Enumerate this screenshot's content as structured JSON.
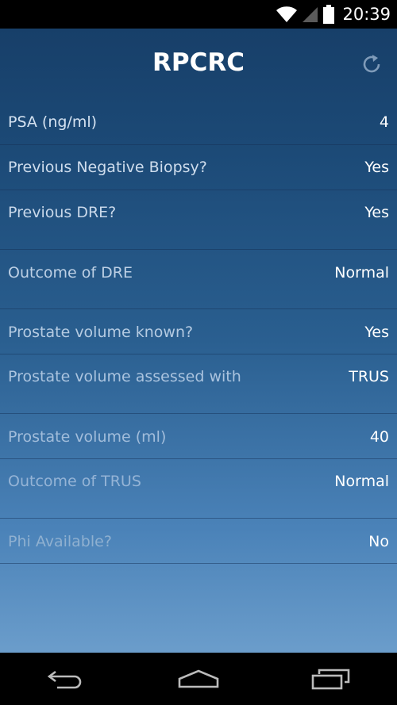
{
  "status_bar": {
    "time": "20:39"
  },
  "header": {
    "title": "RPCRC"
  },
  "rows": [
    {
      "label": "PSA (ng/ml)",
      "value": "4"
    },
    {
      "label": "Previous Negative Biopsy?",
      "value": "Yes"
    },
    {
      "label": "Previous DRE?",
      "value": "Yes"
    },
    {
      "label": "Outcome of DRE",
      "value": "Normal"
    },
    {
      "label": "Prostate volume known?",
      "value": "Yes"
    },
    {
      "label": "Prostate volume assessed with",
      "value": "TRUS"
    },
    {
      "label": "Prostate volume (ml)",
      "value": "40"
    },
    {
      "label": "Outcome of TRUS",
      "value": "Normal"
    },
    {
      "label": "Phi Available?",
      "value": "No"
    }
  ],
  "colors": {
    "header_top": "#173f69",
    "background_bottom": "#6b9dcb",
    "label_bright": "#d4e2f1",
    "label_faded": "#8fb0d0"
  },
  "icons": {
    "status": [
      "wifi-icon",
      "signal-icon",
      "battery-icon"
    ],
    "header": "refresh-icon",
    "nav": [
      "back-icon",
      "home-icon",
      "recent-apps-icon"
    ]
  }
}
